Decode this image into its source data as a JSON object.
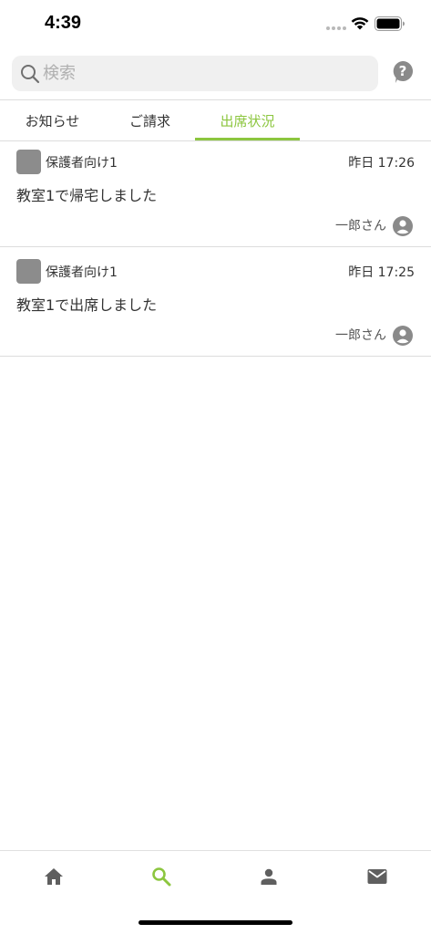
{
  "status_bar": {
    "time": "4:39"
  },
  "search": {
    "placeholder": "検索"
  },
  "tabs": [
    {
      "label": "お知らせ",
      "active": false
    },
    {
      "label": "ご請求",
      "active": false
    },
    {
      "label": "出席状況",
      "active": true
    }
  ],
  "notifications": [
    {
      "group": "保護者向け1",
      "time": "昨日 17:26",
      "message": "教室1で帰宅しました",
      "sender": "一郎さん"
    },
    {
      "group": "保護者向け1",
      "time": "昨日 17:25",
      "message": "教室1で出席しました",
      "sender": "一郎さん"
    }
  ],
  "bottom_nav": [
    {
      "icon": "home-icon",
      "active": false
    },
    {
      "icon": "search-icon",
      "active": true
    },
    {
      "icon": "person-icon",
      "active": false
    },
    {
      "icon": "mail-icon",
      "active": false
    }
  ],
  "colors": {
    "accent": "#8cc63f",
    "icon_gray": "#5f5f5f",
    "avatar_gray": "#8c8c8c",
    "divider": "#dcdcdc"
  }
}
